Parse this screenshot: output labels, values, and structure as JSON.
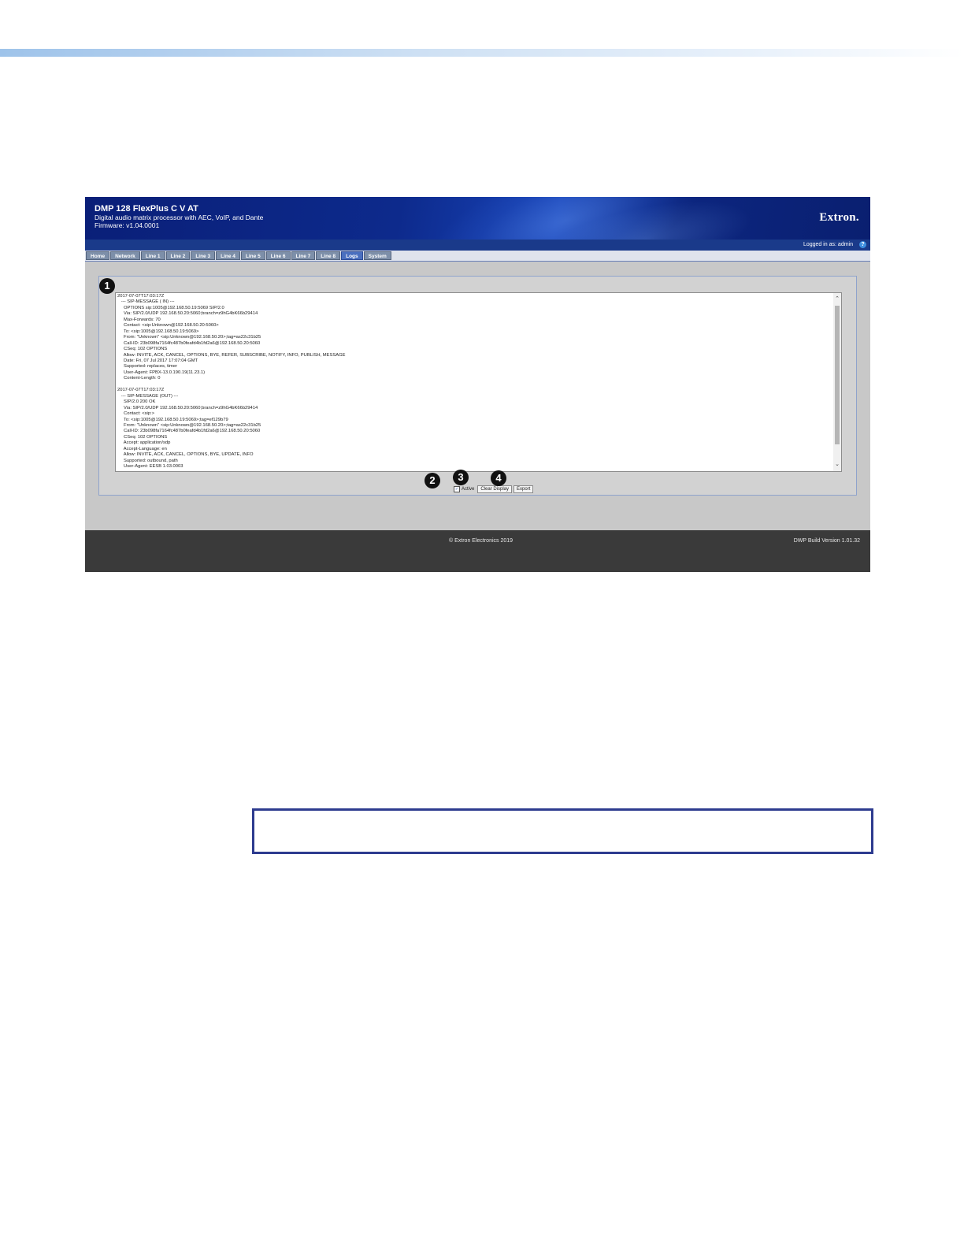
{
  "app": {
    "title": "DMP 128 FlexPlus C V AT",
    "subtitle": "Digital audio matrix processor with AEC, VoIP, and Dante",
    "firmware": "Firmware: v1.04.0001",
    "brand": "Extron.",
    "login_status": "Logged in as: admin",
    "help_symbol": "?"
  },
  "tabs": [
    {
      "label": "Home",
      "active": false
    },
    {
      "label": "Network",
      "active": false
    },
    {
      "label": "Line 1",
      "active": false
    },
    {
      "label": "Line 2",
      "active": false
    },
    {
      "label": "Line 3",
      "active": false
    },
    {
      "label": "Line 4",
      "active": false
    },
    {
      "label": "Line 5",
      "active": false
    },
    {
      "label": "Line 6",
      "active": false
    },
    {
      "label": "Line 7",
      "active": false
    },
    {
      "label": "Line 8",
      "active": false
    },
    {
      "label": "Logs",
      "active": true
    },
    {
      "label": "System",
      "active": false
    }
  ],
  "log": {
    "lines": [
      "2017-07-07T17:03:17Z",
      "   --- SIP-MESSAGE ( IN) ---",
      "     OPTIONS sip:1005@192.168.50.19:5069 SIP/2.0",
      "     Via: SIP/2.0/UDP 192.168.50.20:5060;branch=z9hG4bK66b29414",
      "     Max-Forwards: 70",
      "     Contact: <sip:Unknown@192.168.50.20:5060>",
      "     To: <sip:1005@192.168.50.19:5069>",
      "     From: \"Unknown\" <sip:Unknown@192.168.50.20>;tag=as22c31b25",
      "     Call-ID: 23b098fa7164fc487b0feafd4b1fd2a6@192.168.50.20:5060",
      "     CSeq: 102 OPTIONS",
      "     Allow: INVITE, ACK, CANCEL, OPTIONS, BYE, REFER, SUBSCRIBE, NOTIFY, INFO, PUBLISH, MESSAGE",
      "     Date: Fri, 07 Jul 2017 17:07:04 GMT",
      "     Supported: replaces, timer",
      "     User-Agent: FPBX-13.0.190.19(11.23.1)",
      "     Content-Length: 0",
      "",
      "2017-07-07T17:03:17Z",
      "   --- SIP-MESSAGE (OUT) ---",
      "     SIP/2.0 200 OK",
      "     Via: SIP/2.0/UDP 192.168.50.20:5060;branch=z9hG4bK66b29414",
      "     Contact: <sip:>",
      "     To: <sip:1005@192.168.50.19:5069>;tag=ef129b79",
      "     From: \"Unknown\" <sip:Unknown@192.168.50.20>;tag=as22c31b25",
      "     Call-ID: 23b098fa7164fc487b0feafd4b1fd2a6@192.168.50.20:5060",
      "     CSeq: 102 OPTIONS",
      "     Accept: application/sdp",
      "     Accept-Language: en",
      "     Allow: INVITE, ACK, CANCEL, OPTIONS, BYE, UPDATE, INFO",
      "     Supported: outbound, path",
      "     User-Agent: EESB 1.03.0003"
    ]
  },
  "controls": {
    "active_checked": true,
    "active_label": "Active",
    "clear_label": "Clear Display",
    "export_label": "Export"
  },
  "callouts": {
    "one": "1",
    "two": "2",
    "three": "3",
    "four": "4"
  },
  "footer": {
    "copyright": "© Extron Electronics 2019",
    "build": "DWP Build Version 1.01.32"
  },
  "icons": {
    "scroll_up": "⌃",
    "scroll_down": "⌄",
    "check": "✓"
  }
}
